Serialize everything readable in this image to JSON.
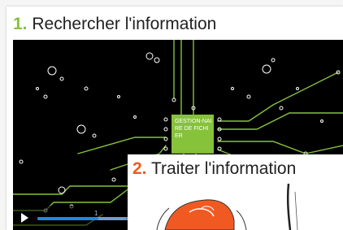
{
  "section1": {
    "number": "1.",
    "title": "Rechercher l'information",
    "video": {
      "box_label": "GESTION-NAIRE DE FICHIER",
      "progress_percent": 30,
      "time_label": "1"
    }
  },
  "section2": {
    "number": "2.",
    "title": "Traiter l'information"
  },
  "colors": {
    "accent_green": "#86c23a",
    "accent_orange": "#f05a22",
    "progress_blue": "#1e88e5"
  }
}
